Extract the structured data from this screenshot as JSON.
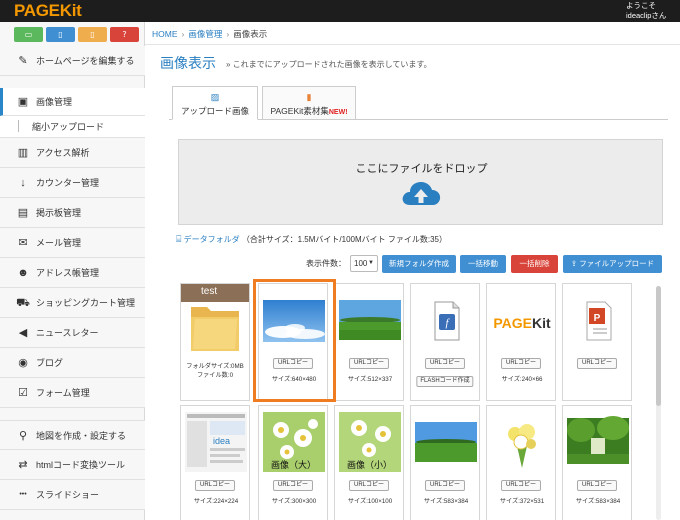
{
  "app": {
    "logo": "PAGEKit",
    "welcome": "ようこそ",
    "user": "ideaclipさん",
    "colors": {
      "accent": "#2a7fc1",
      "logo": "#f39800",
      "highlight": "#f07c22"
    }
  },
  "mode_buttons": [
    {
      "icon": "desktop-icon",
      "glyph": "▭",
      "color": "#5cb85c"
    },
    {
      "icon": "tablet-icon",
      "glyph": "▯",
      "color": "#3f8fd2"
    },
    {
      "icon": "mobile-icon",
      "glyph": "▯",
      "color": "#f0ad4e"
    },
    {
      "icon": "help-icon",
      "glyph": "?",
      "color": "#d9443a"
    }
  ],
  "sidebar": {
    "items": [
      {
        "label": "ホームページを編集する",
        "icon": "edit-icon",
        "glyph": "✎"
      },
      {
        "label": "画像管理",
        "icon": "image-icon",
        "glyph": "▣",
        "active": true
      },
      {
        "label": "縮小アップロード",
        "icon": "",
        "glyph": "",
        "sub": true
      },
      {
        "label": "アクセス解析",
        "icon": "bar-chart-icon",
        "glyph": "▥"
      },
      {
        "label": "カウンター管理",
        "icon": "counter-icon",
        "glyph": "↓"
      },
      {
        "label": "掲示板管理",
        "icon": "board-icon",
        "glyph": "▤"
      },
      {
        "label": "メール管理",
        "icon": "mail-icon",
        "glyph": "✉"
      },
      {
        "label": "アドレス帳管理",
        "icon": "users-icon",
        "glyph": "☻"
      },
      {
        "label": "ショッピングカート管理",
        "icon": "cart-icon",
        "glyph": "⛟"
      },
      {
        "label": "ニュースレター",
        "icon": "bullhorn-icon",
        "glyph": "◀"
      },
      {
        "label": "ブログ",
        "icon": "rss-icon",
        "glyph": "◉"
      },
      {
        "label": "フォーム管理",
        "icon": "checkbox-icon",
        "glyph": "☑"
      },
      {
        "label": "地図を作成・設定する",
        "icon": "map-marker-icon",
        "glyph": "⚲"
      },
      {
        "label": "htmlコード変換ツール",
        "icon": "exchange-icon",
        "glyph": "⇄"
      },
      {
        "label": "スライドショー",
        "icon": "ellipsis-icon",
        "glyph": "•••"
      }
    ]
  },
  "breadcrumb": {
    "home": "HOME",
    "section": "画像管理",
    "current": "画像表示"
  },
  "page": {
    "title": "画像表示",
    "desc": "»  これまでにアップロードされた画像を表示しています。"
  },
  "tabs": [
    {
      "label": "アップロード画像",
      "icon": "picture-icon",
      "glyph": "▨",
      "new": ""
    },
    {
      "label": "PAGEKit素材集",
      "icon": "book-icon",
      "glyph": "▮",
      "new": "NEW!"
    }
  ],
  "dropzone": {
    "text": "ここにファイルをドロップ"
  },
  "folder": {
    "link": "データフォルダ",
    "info": "（合計サイズ：1.5Mバイト/100Mバイト ファイル数:35）"
  },
  "toolbar": {
    "count_label": "表示件数：",
    "count_value": "100",
    "new_folder": "新規フォルダ作成",
    "bulk_move": "一括移動",
    "bulk_delete": "一括削除",
    "upload": "ファイルアップロード"
  },
  "grid": {
    "folder": {
      "name": "test",
      "size": "フォルダサイズ:0MB",
      "count": "ファイル数:0"
    },
    "url_copy": "URLコピー",
    "flash_code": "FLASHコード作成",
    "items": [
      {
        "size": "サイズ:640×480",
        "kind": "sky"
      },
      {
        "size": "サイズ:512×337",
        "kind": "field"
      },
      {
        "size": "",
        "kind": "flash"
      },
      {
        "size": "サイズ:240×66",
        "kind": "pagekit"
      },
      {
        "size": "",
        "kind": "ppt"
      },
      {
        "size": "サイズ:224×224",
        "kind": "screenshot"
      },
      {
        "size": "サイズ:300×300",
        "kind": "flower1",
        "overlay": "画像（大）"
      },
      {
        "size": "サイズ:100×100",
        "kind": "flower2",
        "overlay": "画像（小）"
      },
      {
        "size": "サイズ:583×384",
        "kind": "field2"
      },
      {
        "size": "サイズ:372×531",
        "kind": "bouquet"
      },
      {
        "size": "サイズ:583×384",
        "kind": "trees"
      }
    ]
  }
}
